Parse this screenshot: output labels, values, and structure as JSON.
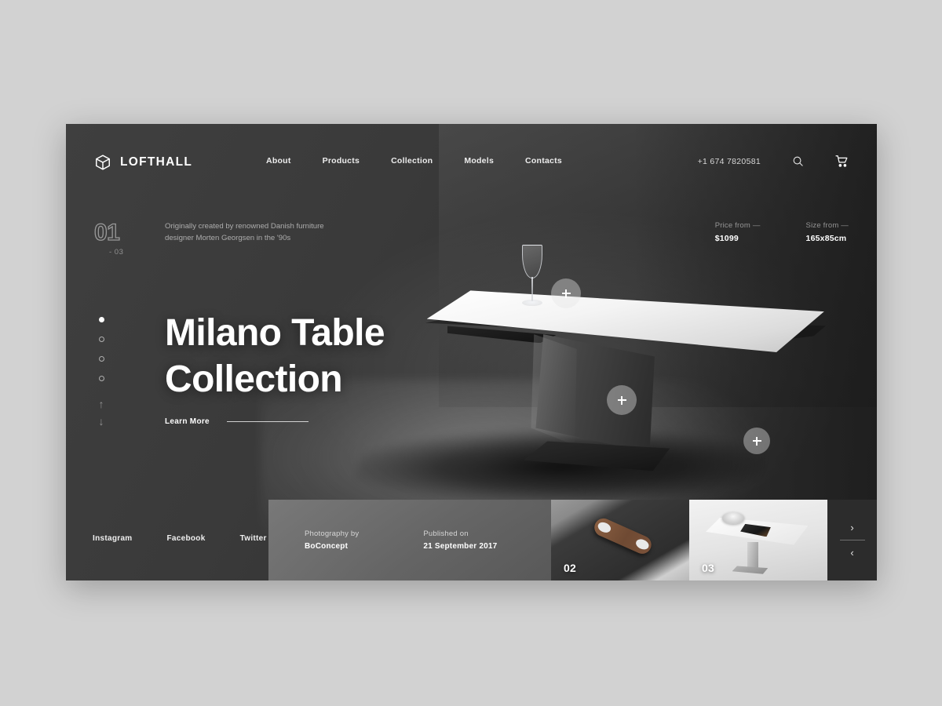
{
  "brand": {
    "name": "LOFTHALL",
    "logo_icon": "cube-icon"
  },
  "nav": {
    "items": [
      {
        "label": "About"
      },
      {
        "label": "Products"
      },
      {
        "label": "Collection"
      },
      {
        "label": "Models"
      },
      {
        "label": "Contacts"
      }
    ]
  },
  "header": {
    "phone": "+1 674 7820581",
    "search_icon": "search-icon",
    "cart_icon": "shopping-cart-icon"
  },
  "slide": {
    "current": "01",
    "total": "- 03",
    "description": "Originally created by renowned Danish furniture designer Morten Georgsen in the '90s",
    "headline_line1": "Milano Table",
    "headline_line2": "Collection",
    "cta": "Learn More"
  },
  "specs": [
    {
      "label": "Price from  —",
      "value": "$1099"
    },
    {
      "label": "Size from —",
      "value": "165x85cm"
    }
  ],
  "rail": {
    "dots": [
      {
        "active": true
      },
      {
        "active": false
      },
      {
        "active": false
      },
      {
        "active": false
      }
    ],
    "up_icon": "arrow-up-icon",
    "down_icon": "arrow-down-icon"
  },
  "hotspots": [
    {
      "icon": "plus-icon"
    },
    {
      "icon": "plus-icon"
    },
    {
      "icon": "plus-icon"
    }
  ],
  "social": {
    "items": [
      {
        "label": "Instagram"
      },
      {
        "label": "Facebook"
      },
      {
        "label": "Twitter"
      }
    ]
  },
  "credits": [
    {
      "label": "Photography by",
      "value": "BoConcept"
    },
    {
      "label": "Published on",
      "value": "21 September 2017"
    }
  ],
  "thumbnails": [
    {
      "number": "02"
    },
    {
      "number": "03"
    }
  ],
  "slider_controls": {
    "next": "›",
    "prev": "‹"
  },
  "colors": {
    "page_background": "#d2d2d2",
    "frame_background": "#3a3a3a",
    "info_strip": "#6f6f6f",
    "accent_text": "#ffffff"
  }
}
